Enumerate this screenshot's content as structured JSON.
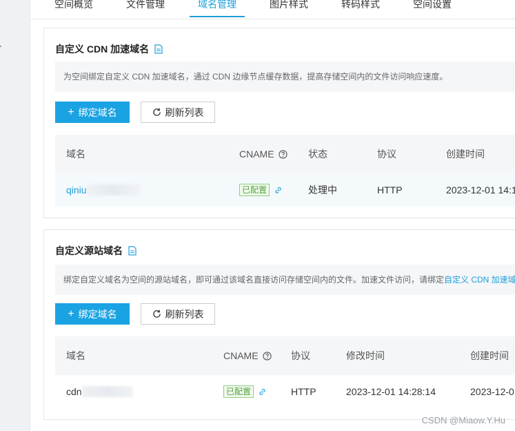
{
  "tabs": [
    "空间概览",
    "文件管理",
    "域名管理",
    "图片样式",
    "转码样式",
    "空间设置"
  ],
  "active_tab": "域名管理",
  "cdn_section": {
    "title": "自定义 CDN 加速域名",
    "description": "为空间绑定自定义 CDN 加速域名，通过 CDN 边缘节点缓存数据，提高存储空间内的文件访问响应速度。",
    "bind_button": "绑定域名",
    "refresh_button": "刷新列表",
    "columns": [
      "域名",
      "CNAME",
      "状态",
      "协议",
      "创建时间"
    ],
    "rows": [
      {
        "domain": "qiniu",
        "cname_status": "已配置",
        "status": "处理中",
        "protocol": "HTTP",
        "created": "2023-12-01 14:1"
      }
    ]
  },
  "source_section": {
    "title": "自定义源站域名",
    "description": "绑定自定义域名为空间的源站域名，即可通过该域名直接访问存储空间内的文件。加速文件访问，请绑定",
    "description_link": "自定义 CDN 加速域",
    "bind_button": "绑定域名",
    "refresh_button": "刷新列表",
    "columns": [
      "域名",
      "CNAME",
      "协议",
      "修改时间",
      "创建时间"
    ],
    "rows": [
      {
        "domain": "cdn",
        "cname_status": "已配置",
        "protocol": "HTTP",
        "modified": "2023-12-01 14:28:14",
        "created": "2023-12-0"
      }
    ]
  },
  "watermark": "CSDN @Miaow.Y.Hu",
  "colors": {
    "accent": "#1e9fda",
    "primary_button": "#1aa3e3",
    "success": "#52a23f"
  }
}
